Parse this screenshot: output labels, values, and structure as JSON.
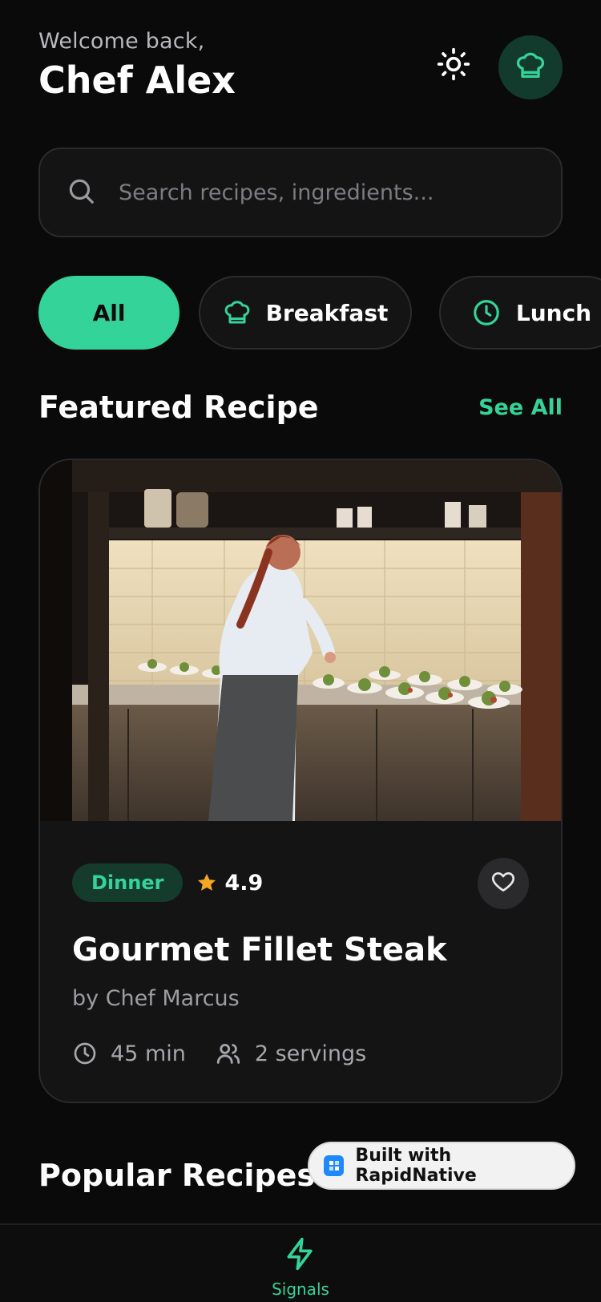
{
  "header": {
    "welcome": "Welcome back,",
    "name": "Chef Alex"
  },
  "search": {
    "placeholder": "Search recipes, ingredients..."
  },
  "categories": [
    {
      "label": "All",
      "active": true
    },
    {
      "label": "Breakfast",
      "icon": "chef-hat-icon"
    },
    {
      "label": "Lunch",
      "icon": "clock-icon"
    }
  ],
  "featured": {
    "title": "Featured Recipe",
    "see_all": "See All",
    "recipe": {
      "category": "Dinner",
      "rating": "4.9",
      "name": "Gourmet Fillet Steak",
      "author": "by Chef Marcus",
      "time": "45 min",
      "servings": "2 servings"
    }
  },
  "popular": {
    "title": "Popular Recipes"
  },
  "badge": {
    "text": "Built with RapidNative"
  },
  "nav": {
    "items": [
      {
        "label": "Signals",
        "icon": "lightning-icon",
        "active": true
      }
    ]
  },
  "colors": {
    "accent": "#34d399",
    "background": "#0a0a0a",
    "card": "#141414",
    "star": "#f5a623"
  }
}
